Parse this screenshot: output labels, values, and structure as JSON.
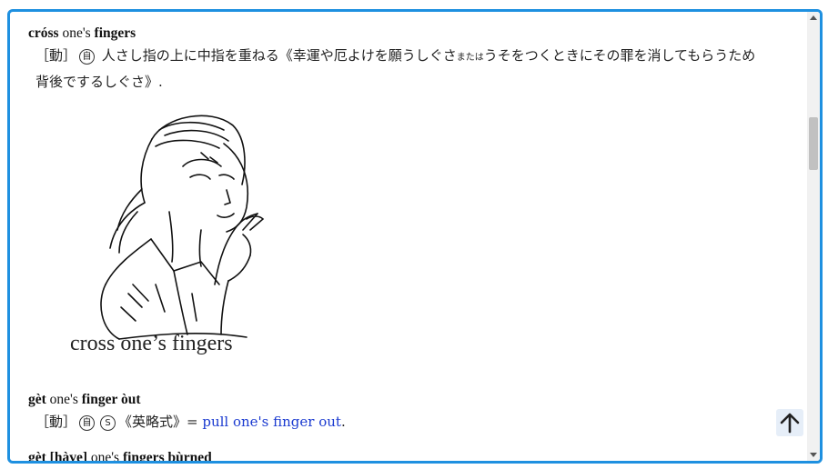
{
  "entries": [
    {
      "head_part1": "cróss",
      "head_part2": " one's ",
      "head_part3": "fingers",
      "def_bracket": "［動］",
      "def_circle": "自",
      "def_text1": " 人さし指の上に中指を重ねる《幸運や厄よけを願うしぐさ",
      "def_small": "または",
      "def_text2": "うそをつくときにその罪を消してもらうため",
      "def_line2": "背後でするしぐさ》."
    },
    {
      "head_part1": "gèt",
      "head_part2": " one's ",
      "head_part3": "finger òut",
      "def_bracket": "［動］",
      "def_circle": "自",
      "def_circle2": "S",
      "def_text1": "《英略式》= ",
      "def_link": "pull one's finger out",
      "def_end": "."
    },
    {
      "head_part1": "gèt [hàve]",
      "head_part2": " one's ",
      "head_part3": "fingers bùrned"
    }
  ],
  "illustration": {
    "caption": "cross one’s fingers",
    "icon": "woman-crossing-fingers-illustration"
  },
  "scroll_top_button": {
    "icon": "arrow-up-icon"
  },
  "colors": {
    "frame_border": "#1e90e0",
    "link": "#1a3ad0"
  }
}
